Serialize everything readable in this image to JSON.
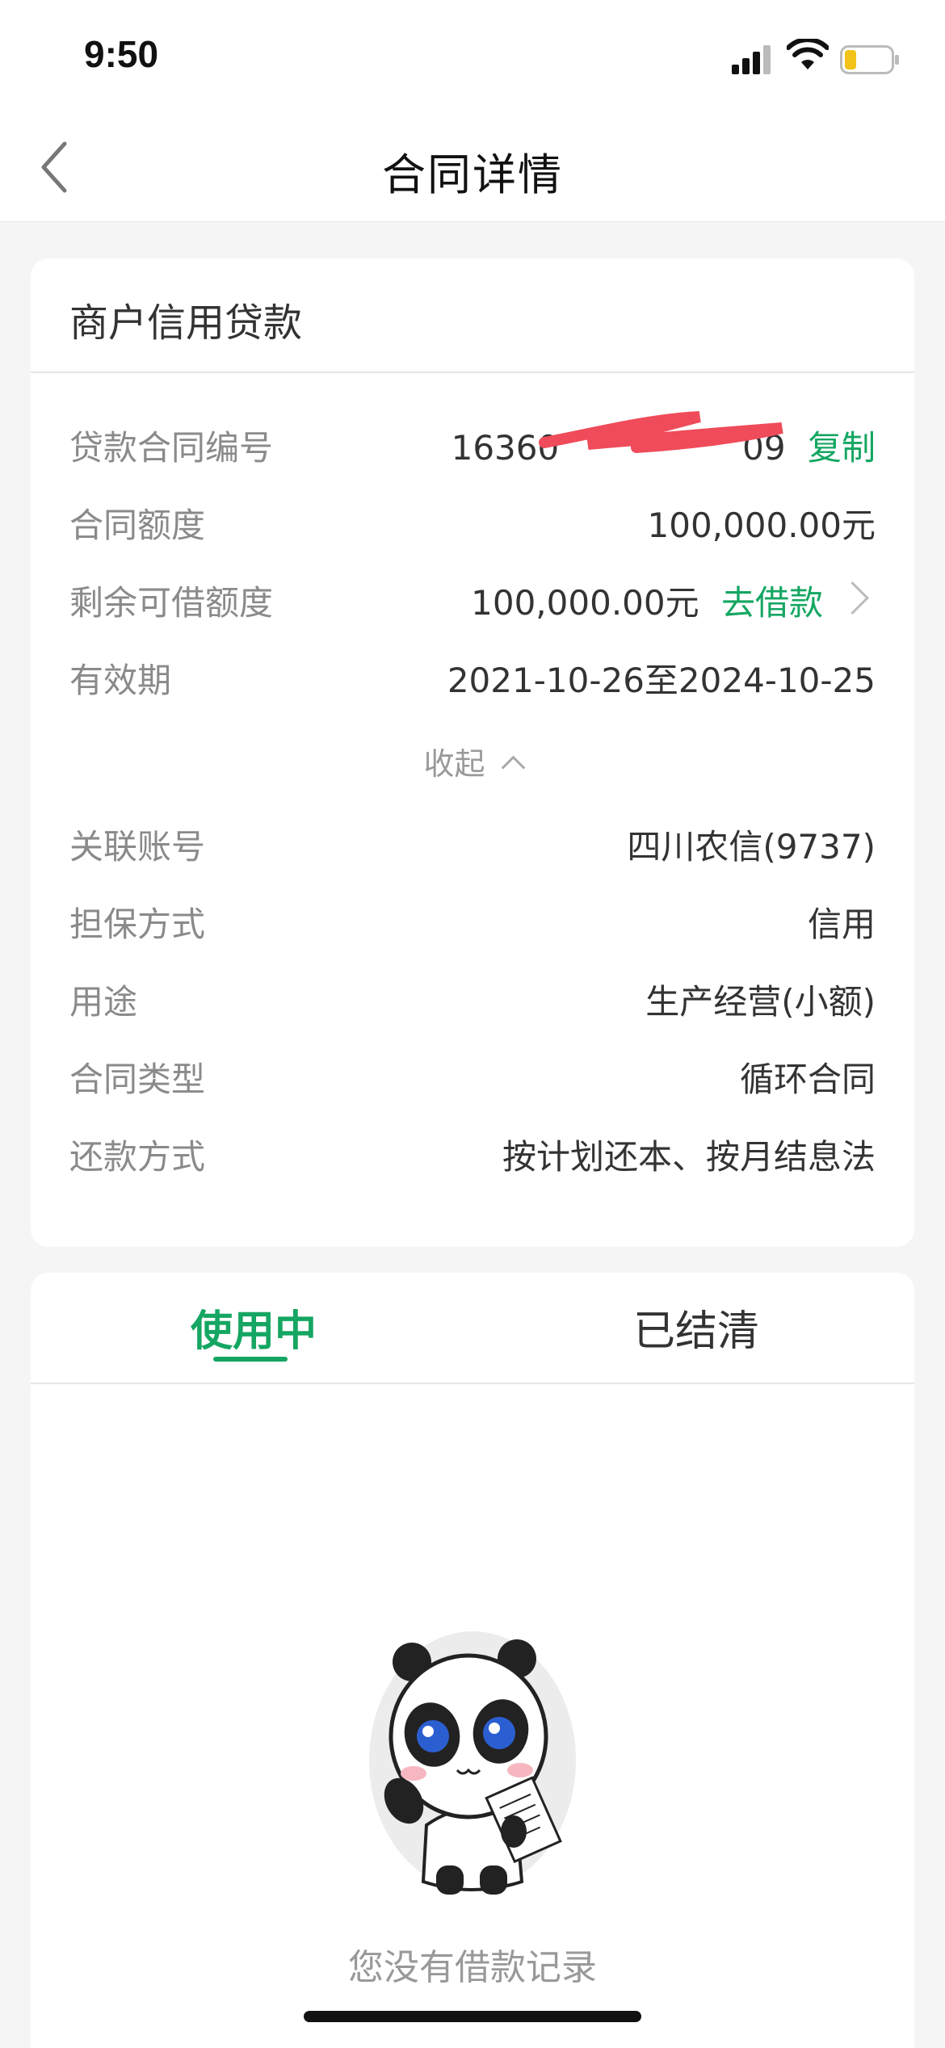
{
  "status_bar": {
    "time": "9:50"
  },
  "nav": {
    "title": "合同详情"
  },
  "contract_card": {
    "title": "商户信用贷款",
    "rows": [
      {
        "label": "贷款合同编号",
        "value": "16360                 09",
        "action": "复制"
      },
      {
        "label": "合同额度",
        "value": "100,000.00元"
      },
      {
        "label": "剩余可借额度",
        "value": "100,000.00元",
        "action": "去借款"
      },
      {
        "label": "有效期",
        "value": "2021-10-26至2024-10-25"
      }
    ],
    "collapse_label": "收起",
    "extra_rows": [
      {
        "label": "关联账号",
        "value": "四川农信(9737)"
      },
      {
        "label": "担保方式",
        "value": "信用"
      },
      {
        "label": "用途",
        "value": "生产经营(小额)"
      },
      {
        "label": "合同类型",
        "value": "循环合同"
      },
      {
        "label": "还款方式",
        "value": "按计划还本、按月结息法"
      }
    ]
  },
  "tabs": [
    {
      "label": "使用中",
      "active": true
    },
    {
      "label": "已结清",
      "active": false
    }
  ],
  "empty_state": {
    "text": "您没有借款记录"
  },
  "colors": {
    "accent": "#14a662",
    "amount": "#ee7d1a"
  }
}
